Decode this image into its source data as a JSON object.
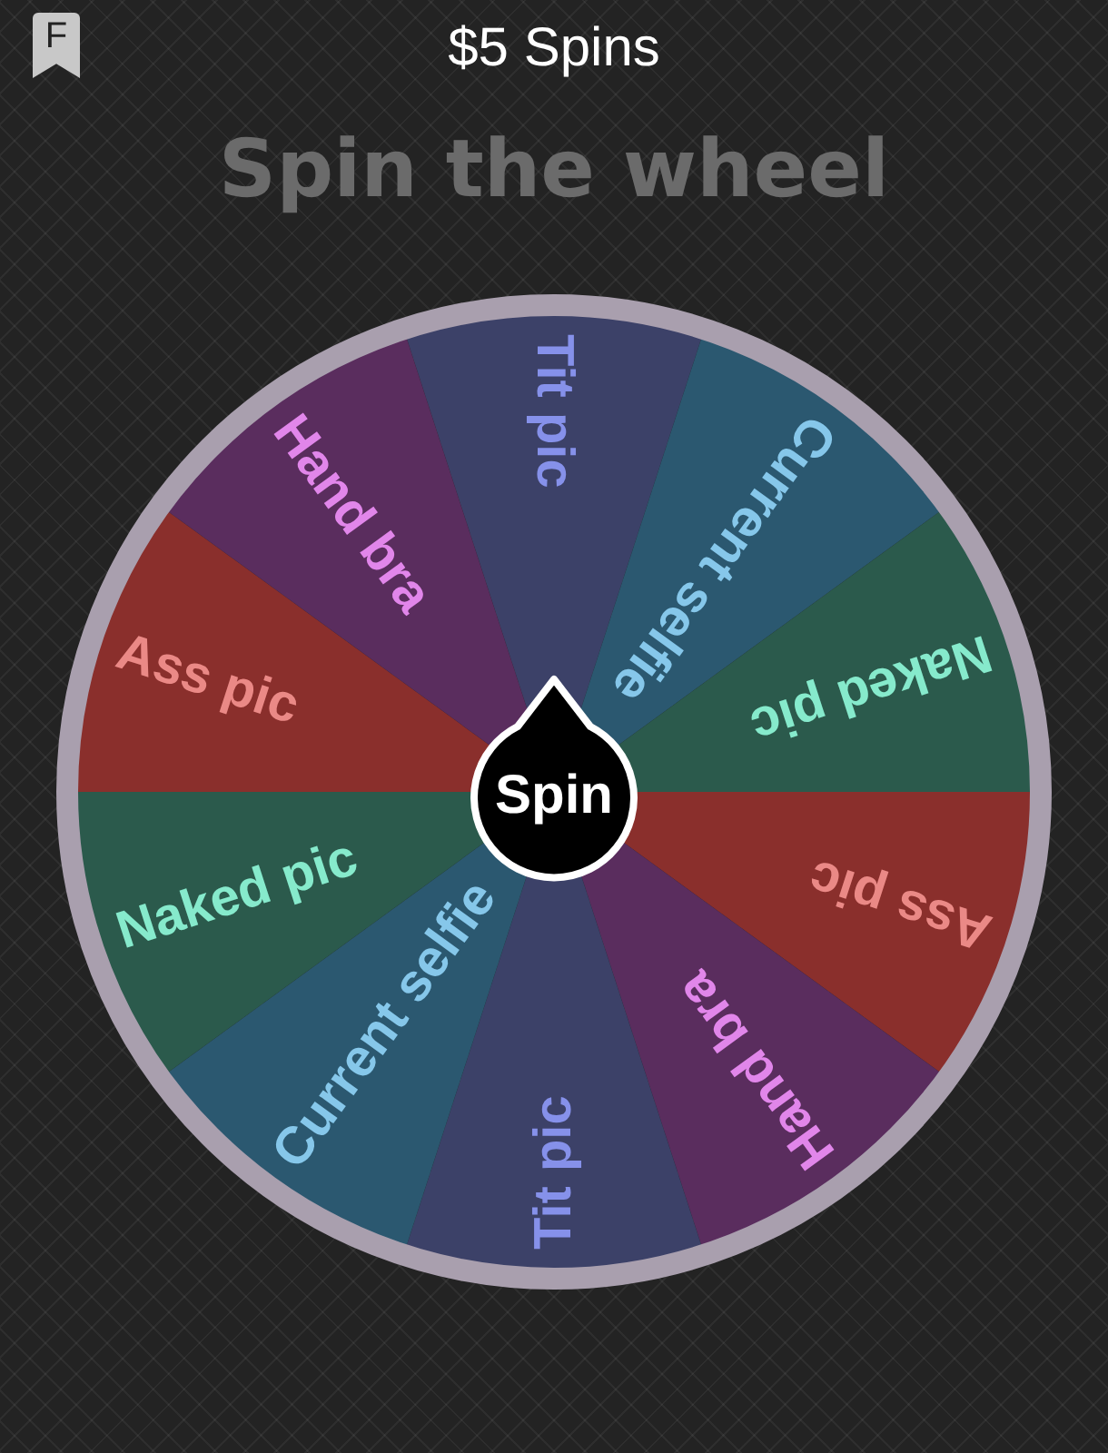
{
  "top_bar": {
    "badge_letter": "F",
    "title": "$5 Spins"
  },
  "heading": "Spin the wheel",
  "wheel": {
    "segments": [
      {
        "label": "Tit pic",
        "color": "#3c4168"
      },
      {
        "label": "Current selfie",
        "color": "#2b5870"
      },
      {
        "label": "Naked pic",
        "color": "#2b5a4c"
      },
      {
        "label": "Ass pic",
        "color": "#8a2f2c"
      },
      {
        "label": "Hand bra",
        "color": "#5a2d5e"
      },
      {
        "label": "Tit pic",
        "color": "#3c4168"
      },
      {
        "label": "Current selfie",
        "color": "#2b5870"
      },
      {
        "label": "Naked pic",
        "color": "#2b5a4c"
      },
      {
        "label": "Ass pic",
        "color": "#8a2f2c"
      },
      {
        "label": "Hand bra",
        "color": "#5a2d5e"
      }
    ]
  },
  "spin_button": {
    "label": "Spin"
  }
}
